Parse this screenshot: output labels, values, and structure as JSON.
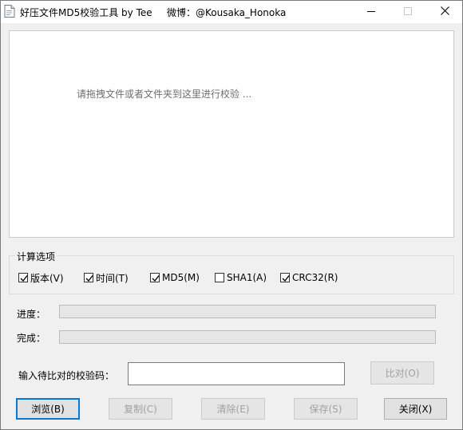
{
  "window": {
    "title": "好压文件MD5校验工具 by Tee",
    "weibo": "微博：@Kousaka_Honoka",
    "controls": {
      "minimize": "—",
      "maximize": "☐",
      "close": "✕"
    }
  },
  "drop_area": {
    "hint": "请拖拽文件或者文件夹到这里进行校验 ..."
  },
  "options": {
    "title": "计算选项",
    "items": [
      {
        "label": "版本(V)",
        "checked": true
      },
      {
        "label": "时间(T)",
        "checked": true
      },
      {
        "label": "MD5(M)",
        "checked": true
      },
      {
        "label": "SHA1(A)",
        "checked": false
      },
      {
        "label": "CRC32(R)",
        "checked": true
      }
    ]
  },
  "progress": {
    "label": "进度：",
    "value": 0
  },
  "complete": {
    "label": "完成：",
    "value": 0
  },
  "compare": {
    "label": "输入待比对的校验码：",
    "value": "",
    "button": "比对(O)"
  },
  "buttons": {
    "browse": "浏览(B)",
    "copy": "复制(C)",
    "clear": "清除(E)",
    "save": "保存(S)",
    "close": "关闭(X)"
  }
}
